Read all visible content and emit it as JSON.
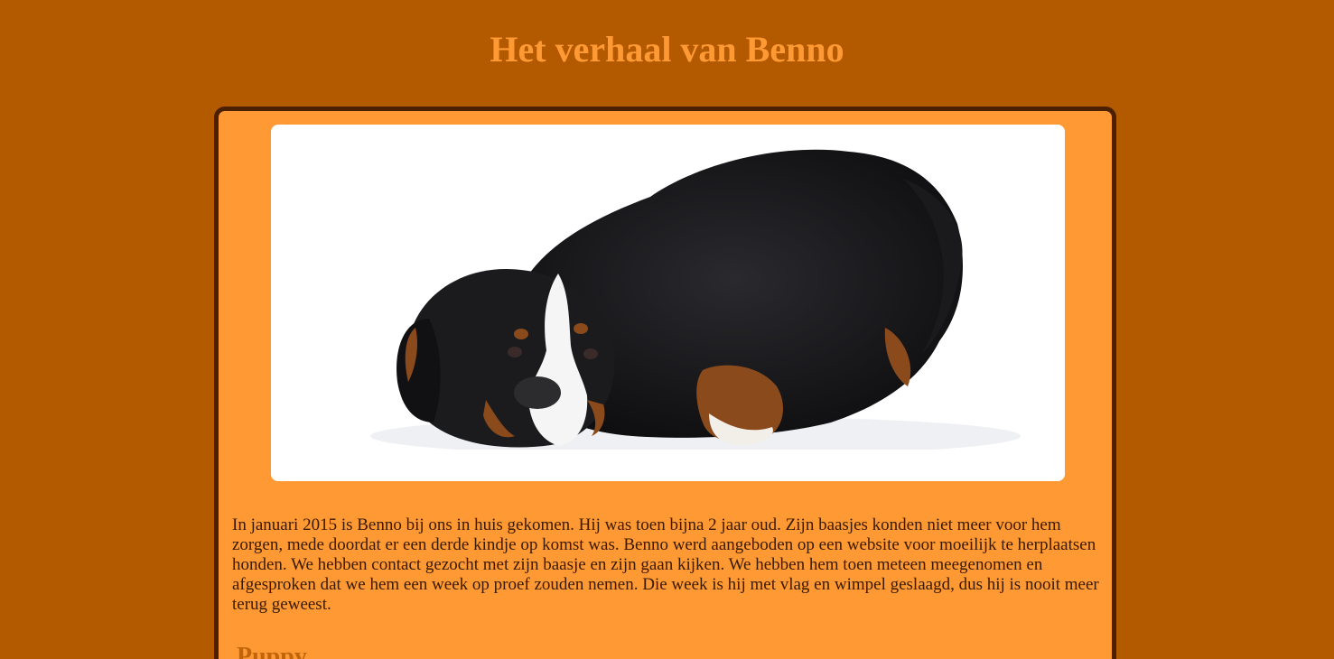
{
  "page": {
    "title": "Het verhaal van Benno",
    "background_color": "#b35900",
    "accent_color": "#ff9933"
  },
  "hero": {
    "image_subject": "bernese-mountain-dog-lying-down"
  },
  "story": {
    "intro": "In januari 2015 is Benno bij ons in huis gekomen. Hij was toen bijna 2 jaar oud. Zijn baasjes konden niet meer voor hem zorgen, mede doordat er een derde kindje op komst was. Benno werd aangeboden op een website voor moeilijk te herplaatsen honden. We hebben contact gezocht met zijn baasje en zijn gaan kijken. We hebben hem toen meteen meegenomen en afgesproken dat we hem een week op proef zouden nemen. Die week is hij met vlag en wimpel geslaagd, dus hij is nooit meer terug geweest.",
    "section_heading": "Puppy"
  }
}
